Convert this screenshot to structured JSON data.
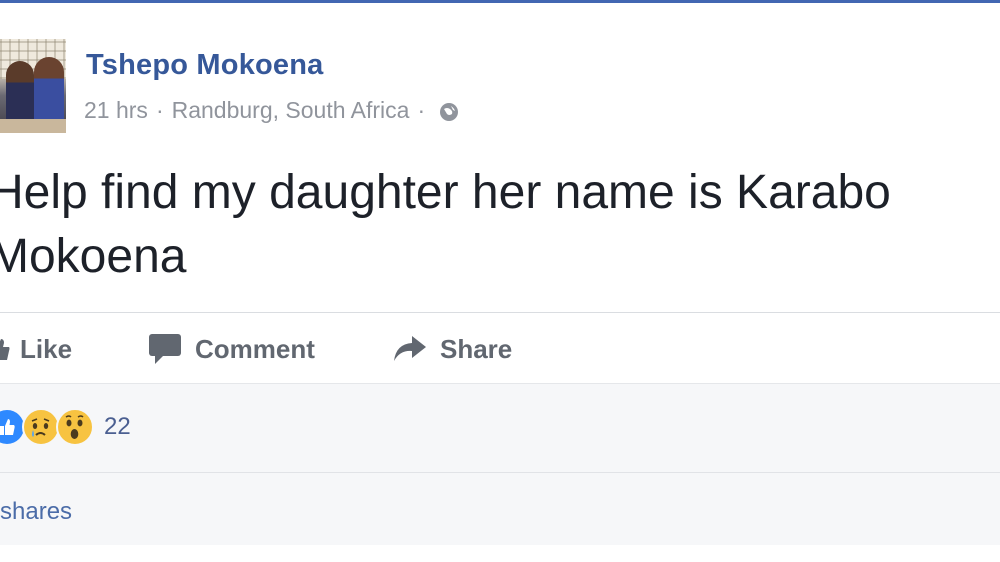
{
  "post": {
    "author": "Tshepo Mokoena",
    "timestamp": "21 hrs",
    "separator": "·",
    "location": "Randburg, South Africa",
    "privacy_icon": "globe-icon",
    "text_lines": [
      "Help find my daughter her name is Karabo",
      "Mokoena"
    ]
  },
  "actions": {
    "like_label": "Like",
    "comment_label": "Comment",
    "share_label": "Share"
  },
  "reactions": {
    "types": [
      "like",
      "sad",
      "wow"
    ],
    "count": "22"
  },
  "shares": {
    "label": "shares"
  },
  "colors": {
    "brand_blue": "#4267b2",
    "author_link": "#365899",
    "meta_gray": "#90949c",
    "text": "#1d2129",
    "action_gray": "#616770",
    "feedback_bg": "#f6f7f9"
  }
}
